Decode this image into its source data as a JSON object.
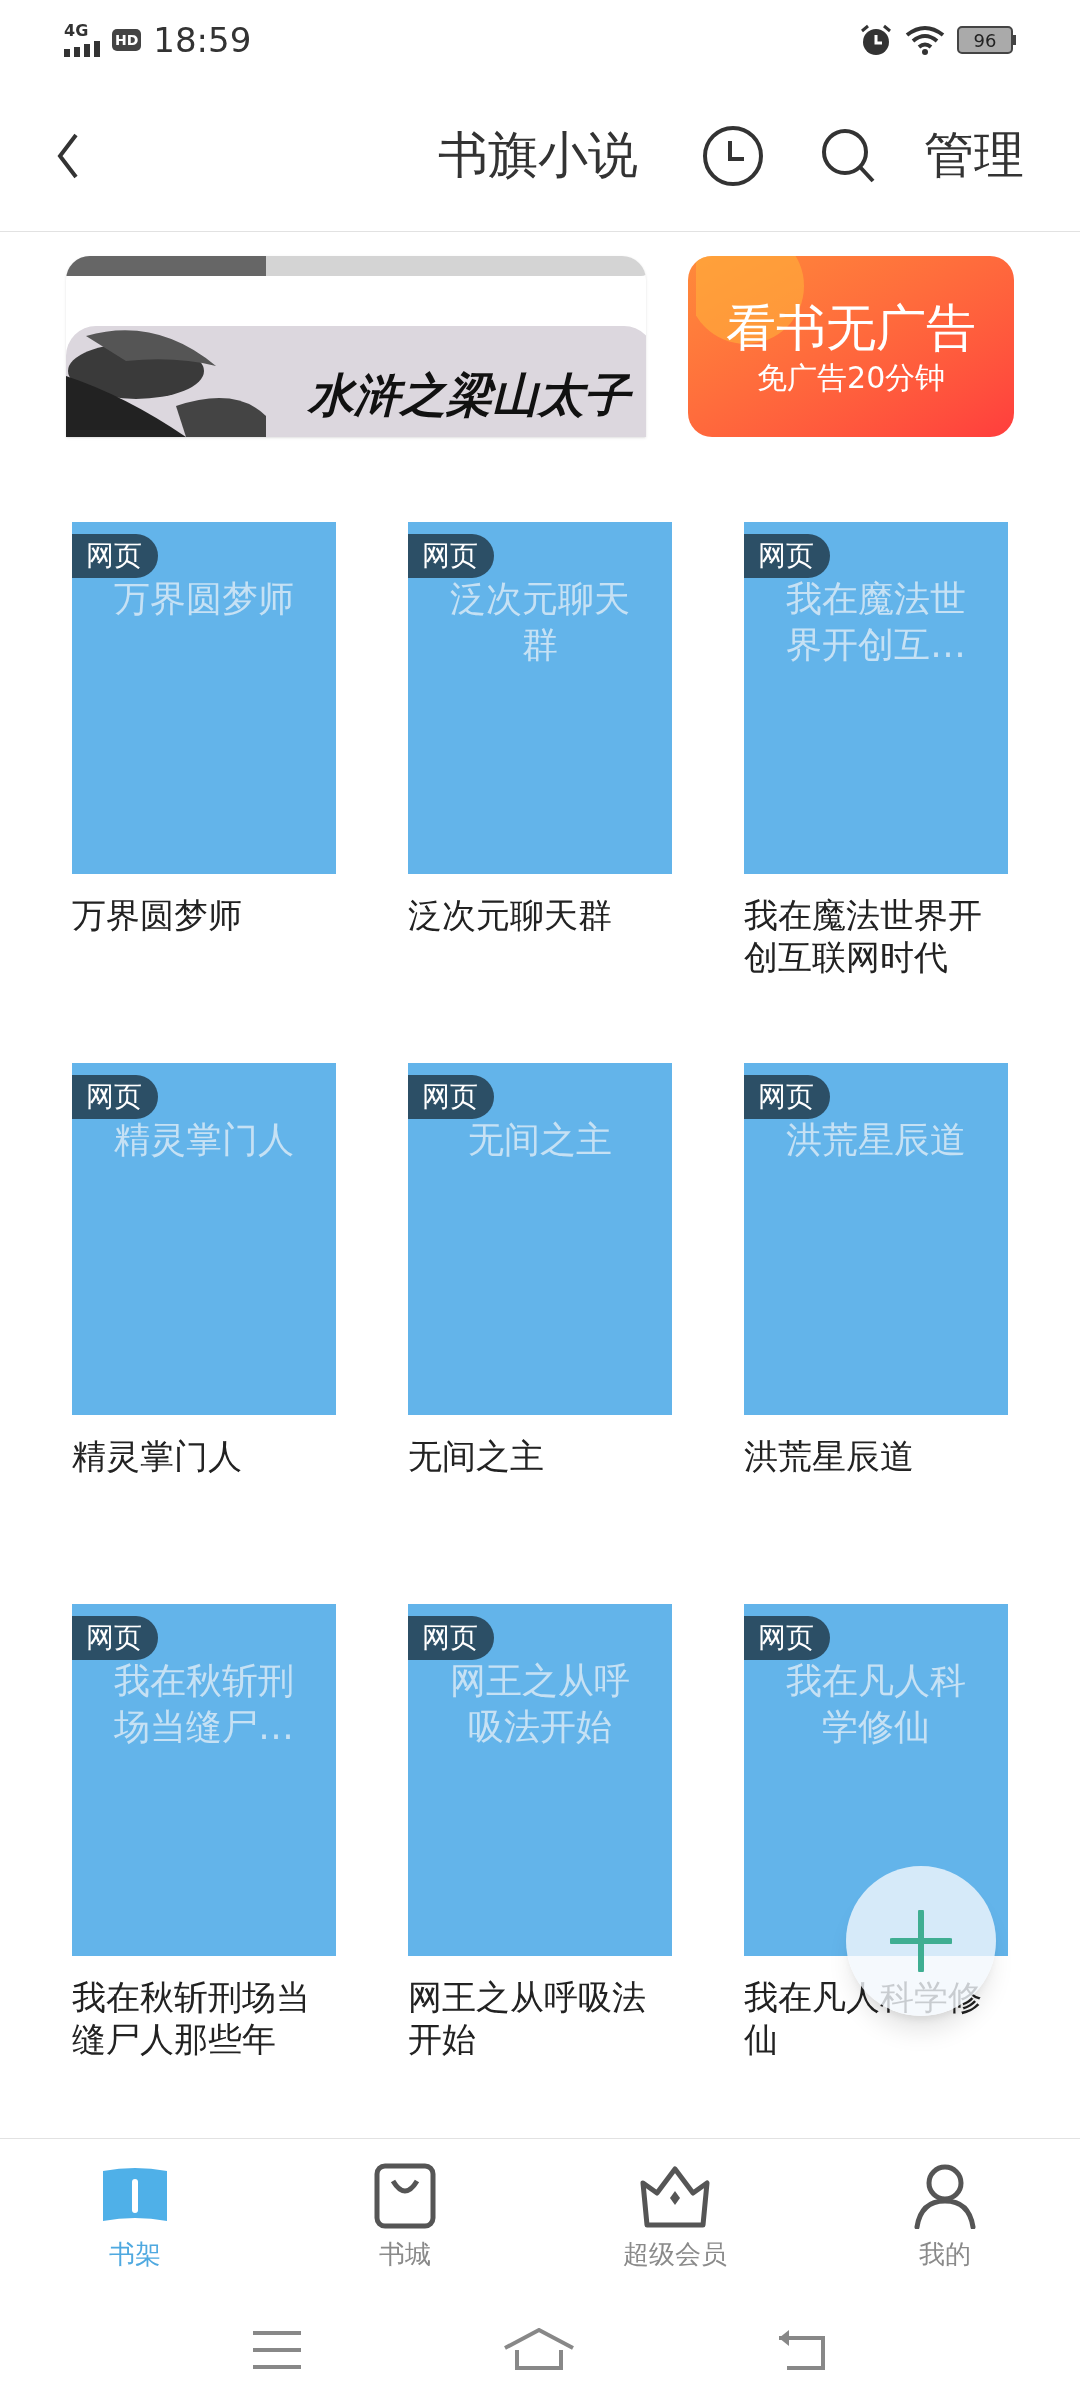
{
  "status_bar": {
    "network": "4G",
    "hd": "HD",
    "time": "18:59",
    "battery": "96"
  },
  "header": {
    "title": "书旗小说",
    "action": "管理"
  },
  "banner": {
    "book_title": "水浒之梁山太子",
    "ad_title": "看书无广告",
    "ad_subtitle": "免广告20分钟"
  },
  "books": [
    {
      "badge": "网页",
      "cover_text": "万界圆梦师",
      "title": "万界圆梦师"
    },
    {
      "badge": "网页",
      "cover_text": "泛次元聊天群",
      "title": "泛次元聊天群"
    },
    {
      "badge": "网页",
      "cover_text": "我在魔法世界开创互…",
      "title": "我在魔法世界开创互联网时代"
    },
    {
      "badge": "网页",
      "cover_text": "精灵掌门人",
      "title": "精灵掌门人"
    },
    {
      "badge": "网页",
      "cover_text": "无间之主",
      "title": "无间之主"
    },
    {
      "badge": "网页",
      "cover_text": "洪荒星辰道",
      "title": "洪荒星辰道"
    },
    {
      "badge": "网页",
      "cover_text": "我在秋斩刑场当缝尸…",
      "title": "我在秋斩刑场当缝尸人那些年"
    },
    {
      "badge": "网页",
      "cover_text": "网王之从呼吸法开始",
      "title": "网王之从呼吸法开始"
    },
    {
      "badge": "网页",
      "cover_text": "我在凡人科学修仙",
      "title": "我在凡人科学修仙"
    }
  ],
  "tabs": [
    {
      "kind": "shelf",
      "label": "书架",
      "selected": true
    },
    {
      "kind": "store",
      "label": "书城",
      "selected": false
    },
    {
      "kind": "vip",
      "label": "超级会员",
      "selected": false
    },
    {
      "kind": "me",
      "label": "我的",
      "selected": false
    }
  ]
}
